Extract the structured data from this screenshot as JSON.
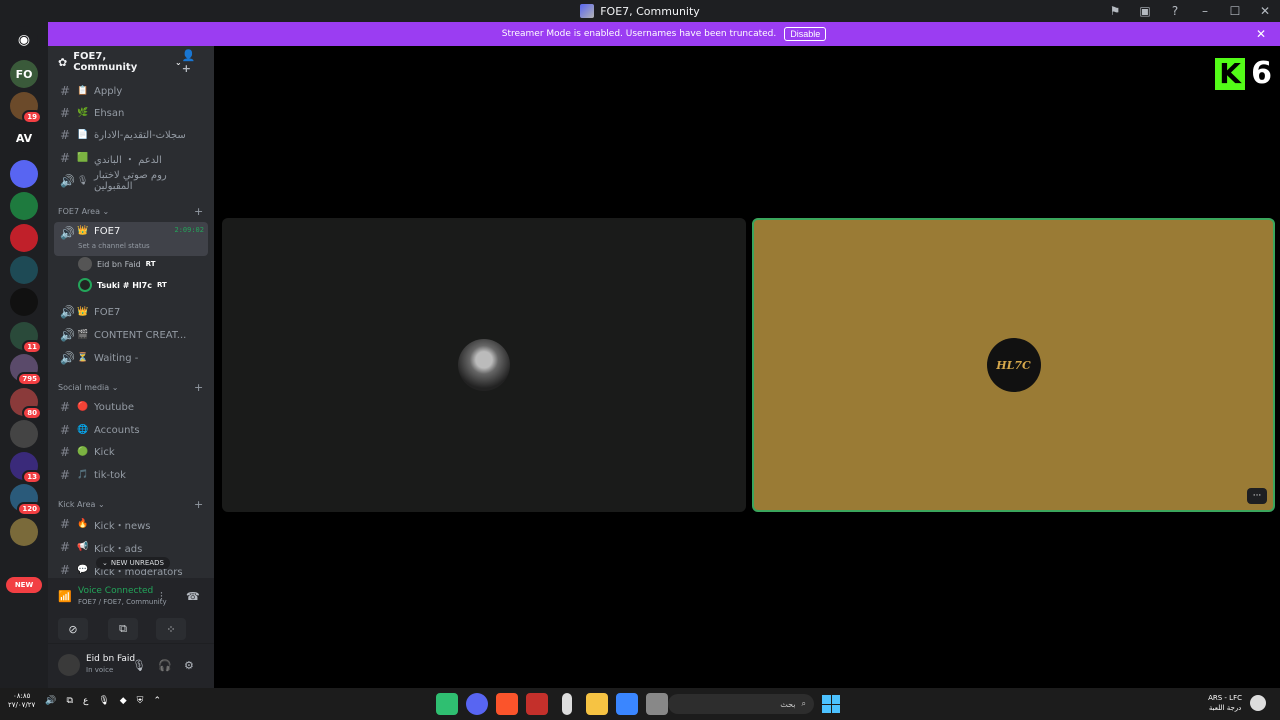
{
  "window": {
    "title": "FOE7, Community"
  },
  "banner": {
    "text": "Streamer Mode is enabled. Usernames have been truncated.",
    "disable_label": "Disable"
  },
  "servers": [
    {
      "label": "FO",
      "badge": "",
      "color": "#3a5a3a"
    },
    {
      "label": "",
      "badge": "19",
      "color": "#6b4a2a"
    },
    {
      "label": "AV",
      "badge": "",
      "color": "#1e1f22"
    },
    {
      "label": "",
      "badge": "",
      "color": "#5865f2"
    },
    {
      "label": "",
      "badge": "",
      "color": "#1e7a3e"
    },
    {
      "label": "",
      "badge": "",
      "color": "#c0202a"
    },
    {
      "label": "",
      "badge": "",
      "color": "#1e4a55"
    },
    {
      "label": "",
      "badge": "",
      "color": "#111111"
    },
    {
      "label": "",
      "badge": "11",
      "color": "#2a4a3a"
    },
    {
      "label": "",
      "badge": "795",
      "color": "#5a4a6a"
    },
    {
      "label": "",
      "badge": "80",
      "color": "#8a3a3a"
    },
    {
      "label": "",
      "badge": "",
      "color": "#444444"
    },
    {
      "label": "",
      "badge": "13",
      "color": "#3a2a7a"
    },
    {
      "label": "",
      "badge": "120",
      "color": "#2a5a7a"
    },
    {
      "label": "",
      "badge": "",
      "color": "#7a6a3a"
    }
  ],
  "new_label": "NEW",
  "guild": {
    "name": "FOE7, Community"
  },
  "channels_top": [
    {
      "emoji": "📋",
      "name": "Apply"
    },
    {
      "emoji": "🌿",
      "name": "Ehsan"
    },
    {
      "emoji": "📄",
      "name": "سجلات-التقديم-الادارة"
    },
    {
      "emoji": "🟩",
      "name": "الدعم ・ الباندي"
    },
    {
      "emoji": "🎙",
      "name": "روم صوتي لاختبار المقبولين"
    }
  ],
  "cat_foe7": "FOE7 Area",
  "active_channel": {
    "name": "FOE7",
    "timer": "2:09:02",
    "sub": "Set a channel status"
  },
  "voice_users": [
    {
      "name": "Eid bn Faid",
      "tag": "RT"
    },
    {
      "name": "Tsuki # Hl7c",
      "tag": "RT"
    }
  ],
  "channels_mid": [
    {
      "emoji": "👑",
      "name": "FOE7"
    },
    {
      "emoji": "🎬",
      "name": "CONTENT CREAT..."
    },
    {
      "emoji": "⏳",
      "name": "Waiting -"
    }
  ],
  "cat_social": "Social media",
  "channels_social": [
    {
      "emoji": "🔴",
      "name": "Youtube"
    },
    {
      "emoji": "🌐",
      "name": "Accounts"
    },
    {
      "emoji": "🟢",
      "name": "Kick"
    },
    {
      "emoji": "🎵",
      "name": "tik-tok"
    }
  ],
  "cat_kick": "Kick Area",
  "channels_kick": [
    {
      "emoji": "🔥",
      "name": "Kick・news"
    },
    {
      "emoji": "📢",
      "name": "Kick・ads"
    },
    {
      "emoji": "💬",
      "name": "Kick・moderators"
    }
  ],
  "new_unreads": "NEW UNREADS",
  "voice": {
    "status": "Voice Connected",
    "sub": "FOE7 / FOE7, Community"
  },
  "user": {
    "name": "Eid bn Faid",
    "status": "In voice"
  },
  "tiles": {
    "avatar2_text": "HL7C"
  },
  "kick_overlay": {
    "letter": "K",
    "number": "6"
  },
  "taskbar": {
    "search_placeholder": "بحث",
    "time": "٠٨:٨٥",
    "date": "٢٧/٠٧/٢٧",
    "weather_line1": "ARS - LFC",
    "weather_line2": "درجة اللعبة"
  }
}
